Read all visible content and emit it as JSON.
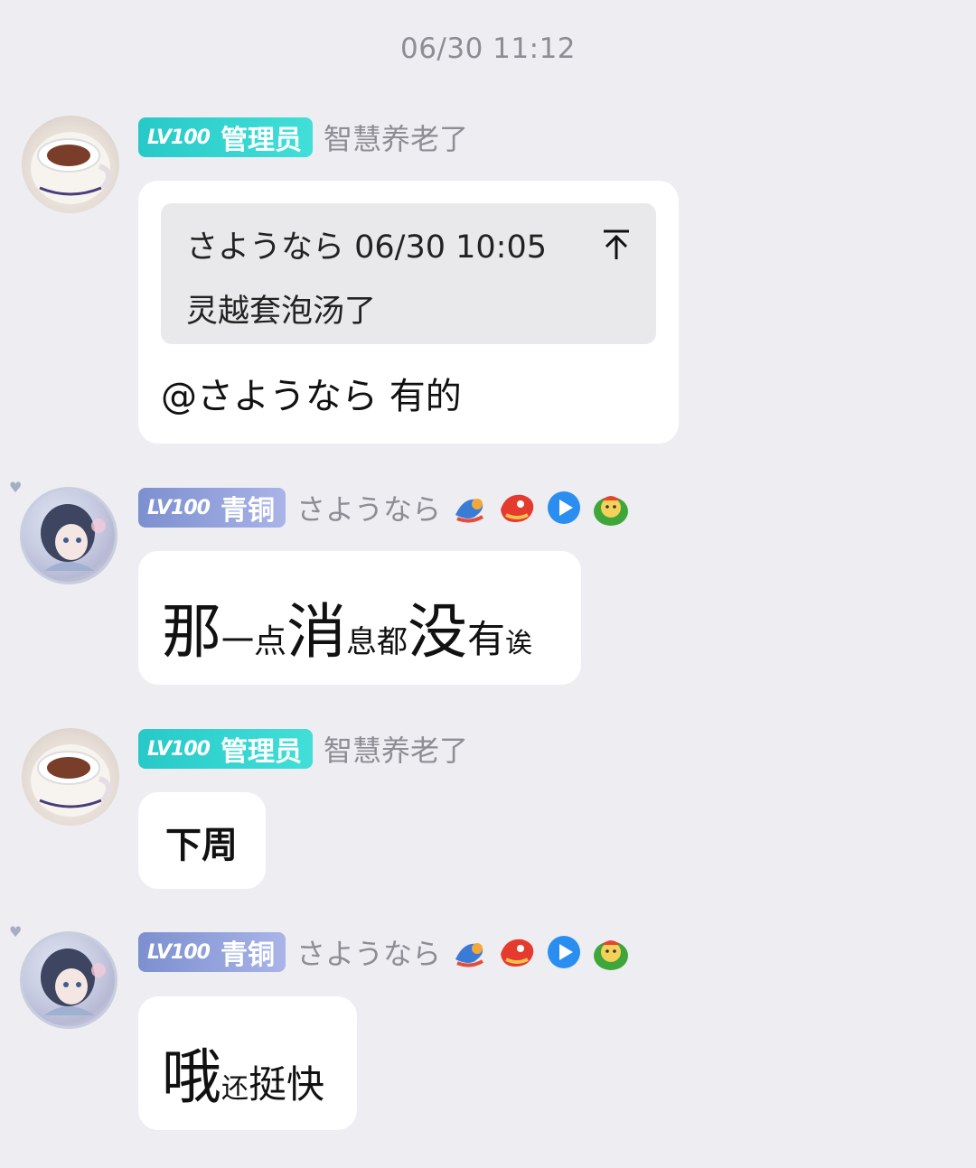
{
  "timestamp": "06/30 11:12",
  "messages": [
    {
      "badge": {
        "level": "LV100",
        "role": "管理员"
      },
      "sender": "智慧养老了",
      "reply": {
        "author_time": "さようなら 06/30 10:05",
        "text": "灵越套泡汤了"
      },
      "text": "@さようなら 有的"
    },
    {
      "badge": {
        "level": "LV100",
        "role": "青铜"
      },
      "sender": "さようなら",
      "decorations": [
        "dragon-icon",
        "dragon-head-icon",
        "play-icon",
        "green-face-icon"
      ],
      "segments": [
        "那",
        "一点",
        "消",
        "息都",
        "没",
        "有",
        "诶"
      ]
    },
    {
      "badge": {
        "level": "LV100",
        "role": "管理员"
      },
      "sender": "智慧养老了",
      "text": "下周"
    },
    {
      "badge": {
        "level": "LV100",
        "role": "青铜"
      },
      "sender": "さようなら",
      "decorations": [
        "dragon-icon",
        "dragon-head-icon",
        "play-icon",
        "green-face-icon"
      ],
      "segments": [
        "哦",
        "还",
        "挺快"
      ]
    }
  ],
  "colors": {
    "admin_badge": "#27c9c8",
    "bronze_badge": "#7c8fcf",
    "background": "#ededf2"
  }
}
